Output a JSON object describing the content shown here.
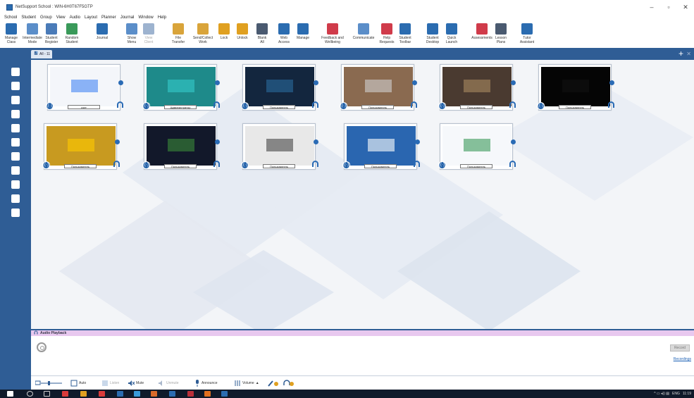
{
  "window": {
    "title": "NetSupport School : WIN-6H0T67F5GTP",
    "controls": [
      "–",
      "▫",
      "✕"
    ]
  },
  "menubar": [
    "School",
    "Student",
    "Group",
    "View",
    "Audio",
    "Layout",
    "Planner",
    "Journal",
    "Window",
    "Help"
  ],
  "toolbar": [
    {
      "label": "Manage\nClass",
      "icon": "manage-class-icon",
      "color": "#2b6cb0"
    },
    {
      "label": "Intermediate\nMode",
      "icon": "intermediate-mode-icon",
      "color": "#5b8ec9"
    },
    {
      "label": "Student\nRegister",
      "icon": "student-register-icon",
      "color": "#4a7bb8"
    },
    {
      "label": "Random\nStudent",
      "icon": "random-student-icon",
      "color": "#3a9a5a"
    },
    {
      "label": "Journal",
      "icon": "journal-icon",
      "color": "#2b6cb0"
    },
    {
      "label": "Show\nMenu",
      "icon": "show-icon",
      "color": "#5b8ec9"
    },
    {
      "label": "View\nClient",
      "icon": "view-icon",
      "color": "#9db3cf",
      "disabled": true
    },
    {
      "label": "File\nTransfer",
      "icon": "file-transfer-icon",
      "color": "#d9a43a"
    },
    {
      "label": "Send/Collect\nWork",
      "icon": "send-collect-icon",
      "color": "#d9a43a"
    },
    {
      "label": "Lock",
      "icon": "lock-icon",
      "color": "#e0a020"
    },
    {
      "label": "Unlock",
      "icon": "unlock-icon",
      "color": "#e0a020"
    },
    {
      "label": "Blank\nAll",
      "icon": "blank-all-icon",
      "color": "#4a5a70"
    },
    {
      "label": "Web\nAccess",
      "icon": "web-access-icon",
      "color": "#2b6cb0"
    },
    {
      "label": "Manage",
      "icon": "manage-icon",
      "color": "#2b6cb0"
    },
    {
      "label": "Feedback and\nWellbeing",
      "icon": "feedback-icon",
      "color": "#d03b4a"
    },
    {
      "label": "Communicate",
      "icon": "communicate-icon",
      "color": "#5b8ec9"
    },
    {
      "label": "Help\nRequests",
      "icon": "help-requests-icon",
      "color": "#d03b4a"
    },
    {
      "label": "Student\nToolbar",
      "icon": "student-toolbar-icon",
      "color": "#2b6cb0"
    },
    {
      "label": "Student\nDesktop",
      "icon": "student-desktop-icon",
      "color": "#2b6cb0"
    },
    {
      "label": "Quick\nLaunch",
      "icon": "quick-launch-icon",
      "color": "#2b6cb0"
    },
    {
      "label": "Assessments",
      "icon": "assessments-icon",
      "color": "#d03b4a"
    },
    {
      "label": "Lesson\nPlans",
      "icon": "lesson-plans-icon",
      "color": "#4a5a70"
    },
    {
      "label": "Tutor\nAssistant",
      "icon": "tutor-assistant-icon",
      "color": "#2b6cb0"
    }
  ],
  "tab": {
    "label": "All - 11"
  },
  "sidebar": [
    "home-icon",
    "monitor-icon",
    "headphones-icon",
    "user-icon",
    "globe-icon",
    "grid-icon",
    "clock-icon",
    "printer-icon",
    "group-icon",
    "apps-icon",
    "survey-icon"
  ],
  "thumbnails": [
    {
      "label": "user",
      "bg": "#f4f6fa",
      "accent": "#4285f4"
    },
    {
      "label": "Администратор",
      "bg": "#1e8a8a",
      "accent": "#3cc"
    },
    {
      "label": "Пользователь",
      "bg": "#13263e",
      "accent": "#2a6a9e"
    },
    {
      "label": "Пользователь",
      "bg": "#8a6a50",
      "accent": "#d0d0d0"
    },
    {
      "label": "Пользователь",
      "bg": "#4a3a30",
      "accent": "#aa8a60"
    },
    {
      "label": "Пользователь",
      "bg": "#050505",
      "accent": "#111"
    },
    {
      "label": "Пользователь",
      "bg": "#c89a20",
      "accent": "#ffcc00"
    },
    {
      "label": "Пользователь",
      "bg": "#12182a",
      "accent": "#3a8a3a"
    },
    {
      "label": "Пользователь",
      "bg": "#e8e8e8",
      "accent": "#444"
    },
    {
      "label": "Пользователь",
      "bg": "#2a66b0",
      "accent": "#fff"
    },
    {
      "label": "Пользователь",
      "bg": "#f6f8fb",
      "accent": "#3a9a5a"
    }
  ],
  "audio_panel": {
    "title": "Audio Playback",
    "record_label": "Record",
    "recordings_link": "Recordings"
  },
  "audio_bar": {
    "auto": "Auto",
    "listen": "Listen",
    "mute": "Mute",
    "unmute": "Unmute",
    "announce": "Announce",
    "volume": "Volume"
  },
  "tray": {
    "lang": "ENG",
    "time": "11:19"
  }
}
